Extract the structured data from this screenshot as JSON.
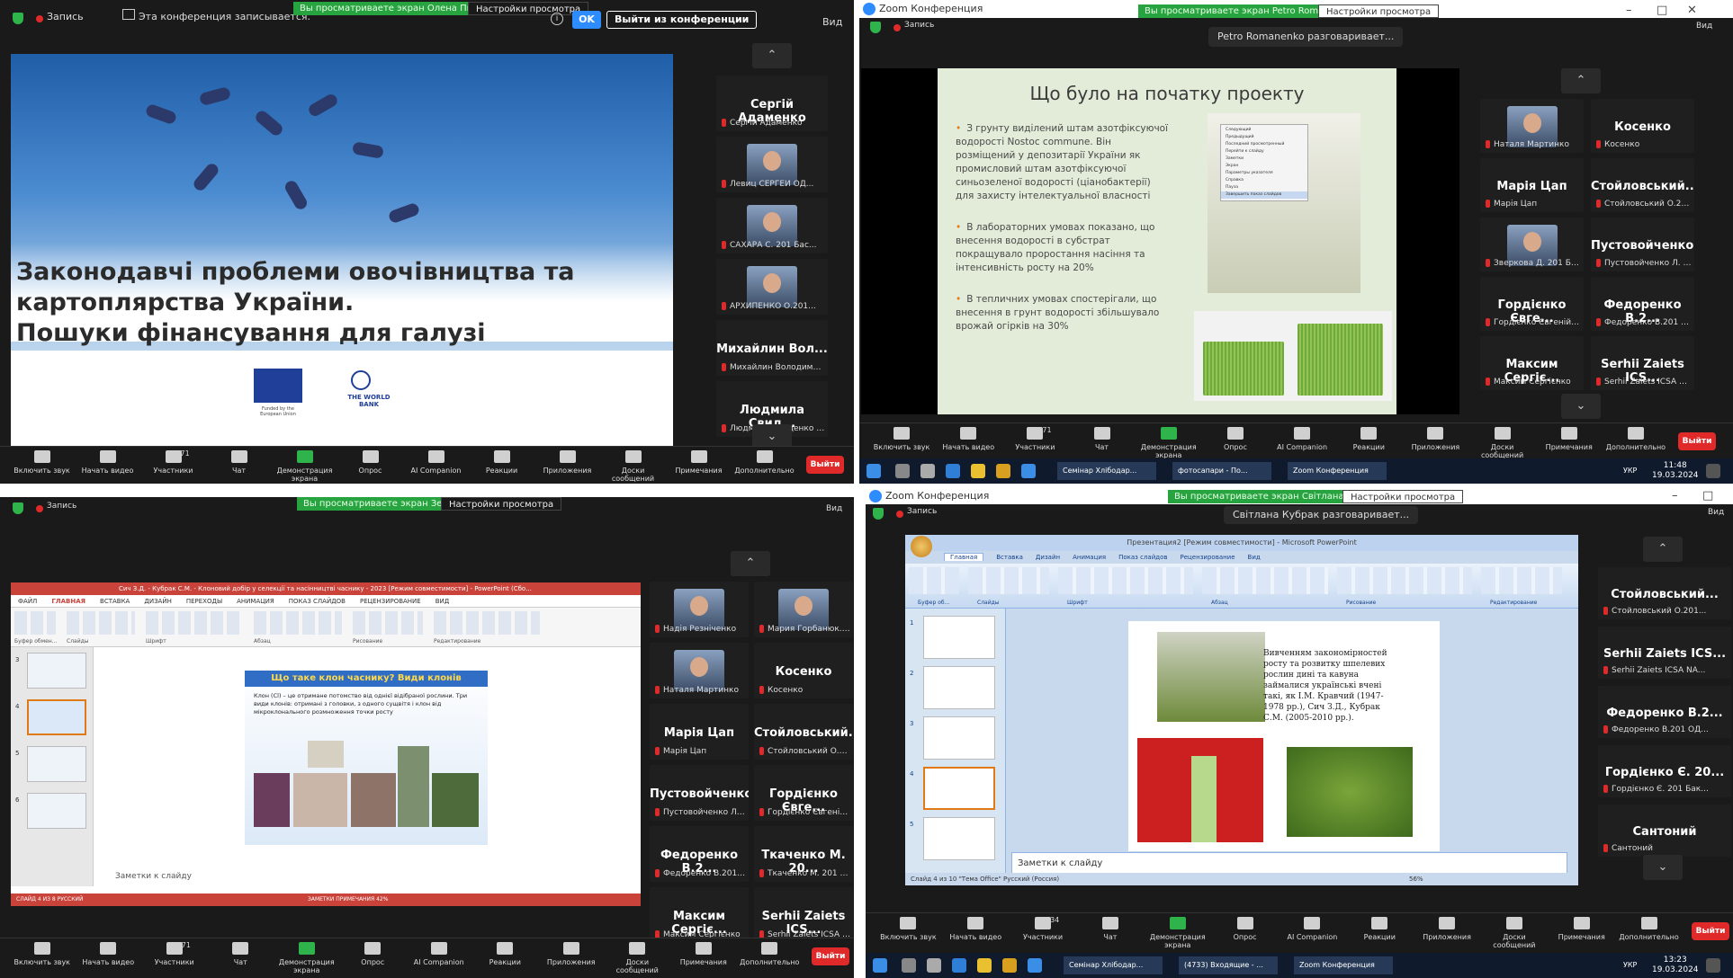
{
  "q1": {
    "rec": "Запись",
    "recording_notice": "Эта конференция записывается.",
    "ok": "OK",
    "leave_meeting": "Выйти из конференции",
    "viewing_tag": "Вы просматриваете экран Олена Пилиуська",
    "view_settings": "Настройки просмотра",
    "view": "Вид",
    "slide_title": [
      "Законодавчі проблеми овочівництва та",
      "картоплярства України.",
      "Пошуки фінансування для галузі"
    ],
    "eu_caption": "Funded by the European Union",
    "wb_caption": "THE WORLD BANK",
    "participants": [
      {
        "name": "Сергій Адаменко",
        "sub": "Сергій Адаменко",
        "video": false
      },
      {
        "name": "",
        "sub": "Левиц СЕРГЕЙ ОД...",
        "video": true
      },
      {
        "name": "",
        "sub": "САХАРА С. 201 Бас...",
        "video": true
      },
      {
        "name": "",
        "sub": "АРХИПЕНКО О.201...",
        "video": true
      },
      {
        "name": "Михайлин Вол...",
        "sub": "Михайлин Володимир, (...",
        "video": false
      },
      {
        "name": "Людмила Свид...",
        "sub": "Людмила Свиденко (...",
        "video": false
      }
    ],
    "toolbar": [
      "Включить звук",
      "Начать видео",
      "Участники",
      "Чат",
      "Демонстрация экрана",
      "Опрос",
      "AI Companion",
      "Реакции",
      "Приложения",
      "Доски сообщений",
      "Примечания",
      "Дополнительно"
    ],
    "participants_count": "71",
    "leave": "Выйти"
  },
  "q2": {
    "window_title": "Zoom Конференция",
    "rec": "Запись",
    "viewing_tag": "Вы просматриваете экран Petro Romanenko",
    "view_settings": "Настройки просмотра",
    "speaking": "Petro Romanenko разговаривает...",
    "view": "Вид",
    "slide_title": "Що було на початку проекту",
    "bullets": [
      "З грунту виділений штам азотфіксуючої водорості Nostoc commune. Він розміщений у депозитарії України як промисловий штам азотфіксуючої синьозеленої водорості (ціанобактерії) для захисту інтелектуальної власності",
      "В лабораторних умовах показано, що внесення водорості в субстрат покращувало проростання насіння та інтенсивність росту на 20%",
      "В тепличних умовах спостерігали, що внесення в грунт водорості збільшувало врожай огірків на 30%"
    ],
    "context_menu": [
      "Следующий",
      "Предыдущий",
      "Последний просмотренный",
      "Перейти к слайду",
      "Заметки",
      "Экран",
      "Параметры указателя",
      "Справка",
      "Пауза",
      "Завершить показ слайдов"
    ],
    "participants": [
      {
        "name": "",
        "sub": "Наталя Мартинко",
        "video": true
      },
      {
        "name": "Косенко",
        "sub": "Косенко",
        "video": false
      },
      {
        "name": "Марія Цап",
        "sub": "Марія Цап",
        "video": false
      },
      {
        "name": "Стойловський...",
        "sub": "Стойловський О.201...",
        "video": false
      },
      {
        "name": "",
        "sub": "Зверкова Д. 201 Бак...",
        "video": true
      },
      {
        "name": "Пустовойченко...",
        "sub": "Пустовойченко Л. 20...",
        "video": false
      },
      {
        "name": "Гордієнко Євге...",
        "sub": "Гордієнко Євгеній 20...",
        "video": false
      },
      {
        "name": "Федоренко В.2...",
        "sub": "Федоренко В.201 ОД...",
        "video": false
      },
      {
        "name": "Максим Сергіє...",
        "sub": "Максим Сергієнко",
        "video": false
      },
      {
        "name": "Serhii Zaiets ICS...",
        "sub": "Serhii Zaiets ICSA NA...",
        "video": false
      }
    ],
    "toolbar": [
      "Включить звук",
      "Начать видео",
      "Участники",
      "Чат",
      "Демонстрация экрана",
      "Опрос",
      "AI Companion",
      "Реакции",
      "Приложения",
      "Доски сообщений",
      "Примечания",
      "Дополнительно"
    ],
    "participants_count": "71",
    "leave": "Выйти",
    "taskbar": [
      "Семінар Хлібодар...",
      "фотосапари - По...",
      "Zoom Конференция"
    ],
    "clock_time": "11:48",
    "clock_date": "19.03.2024",
    "lang": "УКР"
  },
  "q3": {
    "rec": "Запись",
    "viewing_tag": "Вы просматриваете экран Зеленой",
    "view_settings": "Настройки просмотра",
    "view": "Вид",
    "ppt_title": "Сич З.Д. - Кубрак С.М. - Клоновий добір у селекції та насінництві часнику - 2023 [Режим совместимости] - PowerPoint (Сбо...",
    "ppt_menu": [
      "ФАЙЛ",
      "ГЛАВНАЯ",
      "ВСТАВКА",
      "ДИЗАЙН",
      "ПЕРЕХОДЫ",
      "АНИМАЦИЯ",
      "ПОКАЗ СЛАЙДОВ",
      "РЕЦЕНЗИРОВАНИЕ",
      "ВИД"
    ],
    "ribbon_groups": [
      "Буфер обмен...",
      "Слайды",
      "Шрифт",
      "Абзац",
      "Рисование",
      "Редактирование"
    ],
    "slide_title": "Що таке клон часнику? Види клонів",
    "slide_text": "Клон (Cl) – це отримане потомство від однієї відібраної рослини. Три види клонів: отримані з головки, з одного сущвітя і клон від мікроклонального розмноження точки росту",
    "notes": "Заметки к слайду",
    "status": "СЛАЙД 4 ИЗ 8   РУССКИЙ",
    "status_right": "ЗАМЕТКИ   ПРИМЕЧАНИЯ   42%",
    "thumb_numbers": [
      "3",
      "4",
      "5",
      "6"
    ],
    "participants": [
      {
        "name": "",
        "sub": "Надія Резніченко",
        "video": true
      },
      {
        "name": "",
        "sub": "Мария Горбанюк. Ч...",
        "video": true
      },
      {
        "name": "",
        "sub": "Наталя Мартинко",
        "video": true
      },
      {
        "name": "Косенко",
        "sub": "Косенко",
        "video": false
      },
      {
        "name": "Марія Цап",
        "sub": "Марія Цап",
        "video": false
      },
      {
        "name": "Стойловський...",
        "sub": "Стойловський О.201...",
        "video": false
      },
      {
        "name": "Пустовойченко...",
        "sub": "Пустовойченко Л. 20...",
        "video": false
      },
      {
        "name": "Гордієнко Євге...",
        "sub": "Гордієнко Євгеній 20...",
        "video": false
      },
      {
        "name": "Федоренко В.2...",
        "sub": "Федоренко В.201 ОД...",
        "video": false
      },
      {
        "name": "Ткаченко М. 20...",
        "sub": "Ткаченко М. 201 Бак...",
        "video": false
      },
      {
        "name": "Максим Сергіє...",
        "sub": "Максим Сергієнко",
        "video": false
      },
      {
        "name": "Serhii Zaiets ICS...",
        "sub": "Serhii Zaiets ICSA NA...",
        "video": false
      }
    ],
    "toolbar": [
      "Включить звук",
      "Начать видео",
      "Участники",
      "Чат",
      "Демонстрация экрана",
      "Опрос",
      "AI Companion",
      "Реакции",
      "Приложения",
      "Доски сообщений",
      "Примечания",
      "Дополнительно"
    ],
    "participants_count": "71",
    "leave": "Выйти"
  },
  "q4": {
    "window_title": "Zoom Конференция",
    "rec": "Запись",
    "viewing_tag": "Вы просматриваете экран Світлана Кубрак",
    "view_settings": "Настройки просмотра",
    "speaking": "Світлана Кубрак разговаривает...",
    "view": "Вид",
    "ppt_title": "Презентация2 [Режим совместимости] - Microsoft PowerPoint",
    "ppt_tabs": [
      "Главная",
      "Вставка",
      "Дизайн",
      "Анимация",
      "Показ слайдов",
      "Рецензирование",
      "Вид"
    ],
    "ribbon_groups": [
      "Буфер об...",
      "Слайды",
      "Шрифт",
      "Абзац",
      "Рисование",
      "Редактирование"
    ],
    "slide_text": "Вивченням закономірностей росту та розвитку шпелевих рослин дині та кавуна займалися українські вчені такі, як І.М. Кравчий (1947- 1978 рр.), Сич З.Д., Кубрак С.М. (2005-2010 рр.).",
    "notes": "Заметки к слайду",
    "status": "Слайд 4 из 10   \"Тема Office\"   Русский (Россия)",
    "zoom": "56%",
    "thumb_numbers": [
      "1",
      "2",
      "3",
      "4",
      "5"
    ],
    "participants": [
      {
        "name": "Стойловський...",
        "sub": "Стойловський О.201..."
      },
      {
        "name": "Serhii Zaiets ICS...",
        "sub": "Serhii Zaiets ICSA NA..."
      },
      {
        "name": "Федоренко В.2...",
        "sub": "Федоренко В.201 ОД..."
      },
      {
        "name": "Гордієнко Є. 20...",
        "sub": "Гордієнко Є. 201 Бак..."
      },
      {
        "name": "Сантоний",
        "sub": "Сантоний"
      }
    ],
    "toolbar": [
      "Включить звук",
      "Начать видео",
      "Участники",
      "Чат",
      "Демонстрация экрана",
      "Опрос",
      "AI Companion",
      "Реакции",
      "Приложения",
      "Доски сообщений",
      "Примечания",
      "Дополнительно"
    ],
    "participants_count": "34",
    "leave": "Выйти",
    "taskbar": [
      "Семінар Хлібодар...",
      "(4733) Входящие - ...",
      "Zoom Конференция"
    ],
    "clock_time": "13:23",
    "clock_date": "19.03.2024",
    "lang": "УКР"
  }
}
